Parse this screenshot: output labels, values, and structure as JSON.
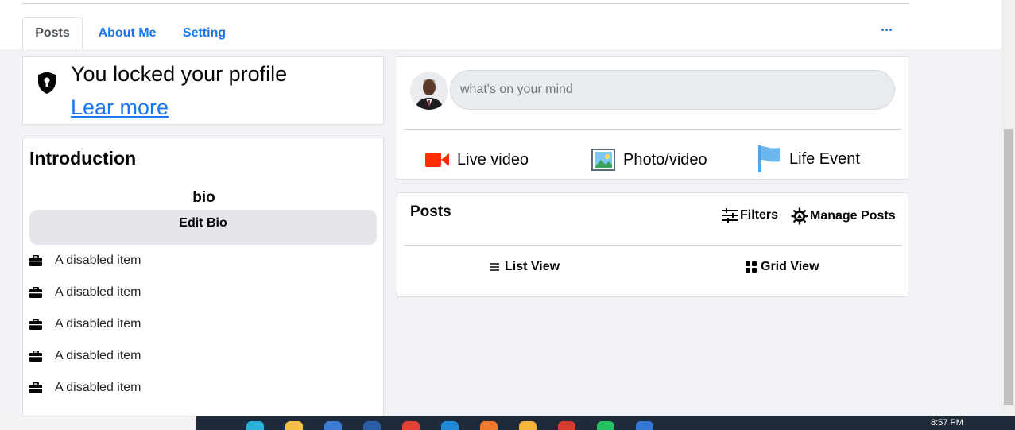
{
  "tabs": [
    {
      "label": "Posts"
    },
    {
      "label": "About Me"
    },
    {
      "label": "Setting"
    }
  ],
  "more_label": "···",
  "lock_card": {
    "title": "You locked your profile",
    "link": "Lear more"
  },
  "intro": {
    "title": "Introduction",
    "bio": "bio",
    "edit_bio": "Edit Bio",
    "items": [
      {
        "label": "A disabled item",
        "icon": "briefcase-icon"
      },
      {
        "label": "A disabled item",
        "icon": "briefcase-icon"
      },
      {
        "label": "A disabled item",
        "icon": "briefcase-icon"
      },
      {
        "label": "A disabled item",
        "icon": "briefcase-icon"
      },
      {
        "label": "A disabled item",
        "icon": "briefcase-icon"
      }
    ]
  },
  "composer": {
    "placeholder": "what's on your mind",
    "actions": [
      {
        "label": "Live video",
        "icon": "video-camera-icon",
        "color": "#f02849"
      },
      {
        "label": "Photo/video",
        "icon": "photo-icon",
        "color": "#45bd62"
      },
      {
        "label": "Life Event",
        "icon": "flag-icon",
        "color": "#4ea6e6"
      }
    ]
  },
  "posts_panel": {
    "title": "Posts",
    "filters": "Filters",
    "manage": "Manage Posts",
    "list_view": "List View",
    "grid_view": "Grid View"
  },
  "taskbar": {
    "time": "8:57 PM"
  },
  "colors": {
    "accent": "#1877f2",
    "background": "#f0f2f5"
  }
}
